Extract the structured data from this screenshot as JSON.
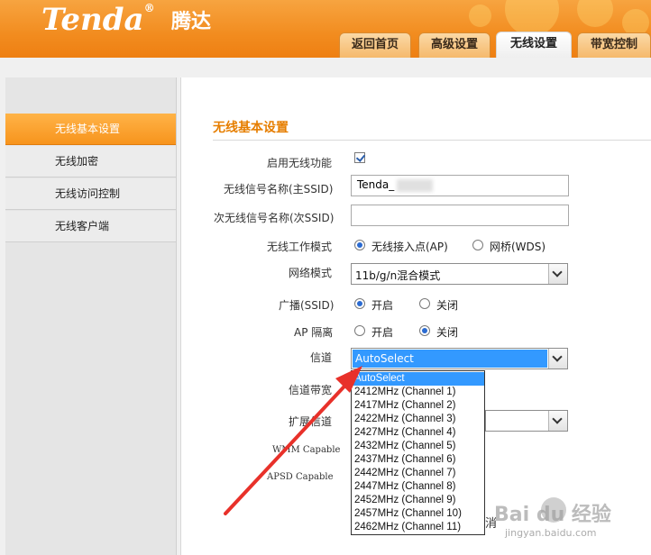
{
  "header": {
    "logo": "Tenda",
    "logo_reg": "®",
    "logo_cn": "腾达",
    "tabs": [
      {
        "label": "返回首页"
      },
      {
        "label": "高级设置"
      },
      {
        "label": "无线设置"
      },
      {
        "label": "带宽控制"
      }
    ],
    "active_tab": 2
  },
  "sidebar": {
    "items": [
      {
        "label": "无线基本设置"
      },
      {
        "label": "无线加密"
      },
      {
        "label": "无线访问控制"
      },
      {
        "label": "无线客户端"
      }
    ],
    "active_index": 0
  },
  "main": {
    "section_title": "无线基本设置",
    "enable_wireless": {
      "label": "启用无线功能",
      "checked": true
    },
    "ssid_primary": {
      "label": "无线信号名称(主SSID)",
      "value": "Tenda_"
    },
    "ssid_secondary": {
      "label": "次无线信号名称(次SSID)",
      "value": ""
    },
    "work_mode": {
      "label": "无线工作模式",
      "options": [
        "无线接入点(AP)",
        "网桥(WDS)"
      ],
      "selected": 0
    },
    "network_mode": {
      "label": "网络模式",
      "value": "11b/g/n混合模式"
    },
    "broadcast": {
      "label": "广播(SSID)",
      "options": [
        "开启",
        "关闭"
      ],
      "selected": 0
    },
    "ap_isolation": {
      "label": "AP 隔离",
      "options": [
        "开启",
        "关闭"
      ],
      "selected": 1
    },
    "channel": {
      "label": "信道",
      "value": "AutoSelect",
      "options": [
        "AutoSelect",
        "2412MHz (Channel 1)",
        "2417MHz (Channel 2)",
        "2422MHz (Channel 3)",
        "2427MHz (Channel 4)",
        "2432MHz (Channel 5)",
        "2437MHz (Channel 6)",
        "2442MHz (Channel 7)",
        "2447MHz (Channel 8)",
        "2452MHz (Channel 9)",
        "2457MHz (Channel 10)",
        "2462MHz (Channel 11)"
      ],
      "highlighted_index": 0
    },
    "channel_bandwidth": {
      "label": "信道带宽"
    },
    "extension_channel": {
      "label": "扩展信道"
    },
    "wmm": {
      "label": "WMM Capable"
    },
    "apsd": {
      "label": "APSD Capable"
    },
    "cancel_fragment": "消"
  },
  "watermark": {
    "text": "Bai du 经验",
    "sub": "jingyan.baidu.com"
  },
  "colors": {
    "accent": "#f7941d",
    "header": "#f28c1f",
    "title": "#e67e00",
    "selection": "#3399ff",
    "arrow": "#e8312a"
  }
}
